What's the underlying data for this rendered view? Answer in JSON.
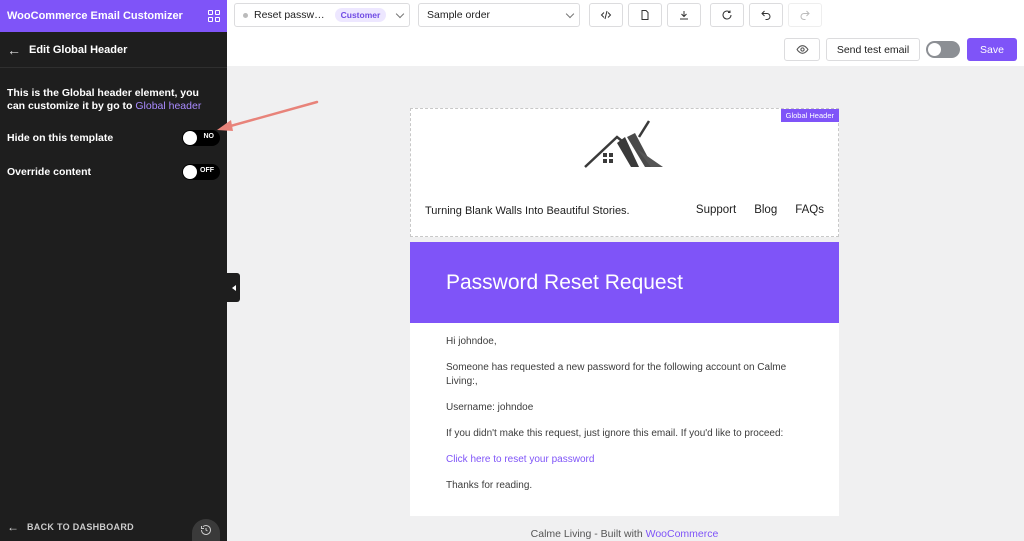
{
  "sidebar": {
    "app_title": "WooCommerce Email Customizer",
    "heading": "Edit Global Header",
    "description": "This is the Global header element, you can customize it by go to",
    "description_link": "Global header",
    "hide_label": "Hide on this template",
    "hide_state": "NO",
    "override_label": "Override content",
    "override_state": "OFF",
    "back_label": "BACK TO DASHBOARD"
  },
  "toolbar": {
    "template_value": "Reset passw…",
    "template_badge": "Customer",
    "order_value": "Sample order",
    "send_test_label": "Send test email",
    "save_label": "Save"
  },
  "email": {
    "header_badge": "Global Header",
    "tagline": "Turning Blank Walls Into Beautiful Stories.",
    "nav": [
      "Support",
      "Blog",
      "FAQs"
    ],
    "banner_title": "Password Reset Request",
    "greeting": "Hi johndoe,",
    "para1": "Someone has requested a new password for the following account on Calme Living:,",
    "username": "Username: johndoe",
    "para2": "If you didn't make this request, just ignore this email. If you'd like to proceed:",
    "reset_link": "Click here to reset your password",
    "thanks": "Thanks for reading.",
    "footer_text": "Calme Living - Built with",
    "footer_link": "WooCommerce"
  },
  "colors": {
    "accent": "#7f54f8",
    "sidebar_bg": "#1e1e1e",
    "annotation_arrow": "#e8837a"
  }
}
